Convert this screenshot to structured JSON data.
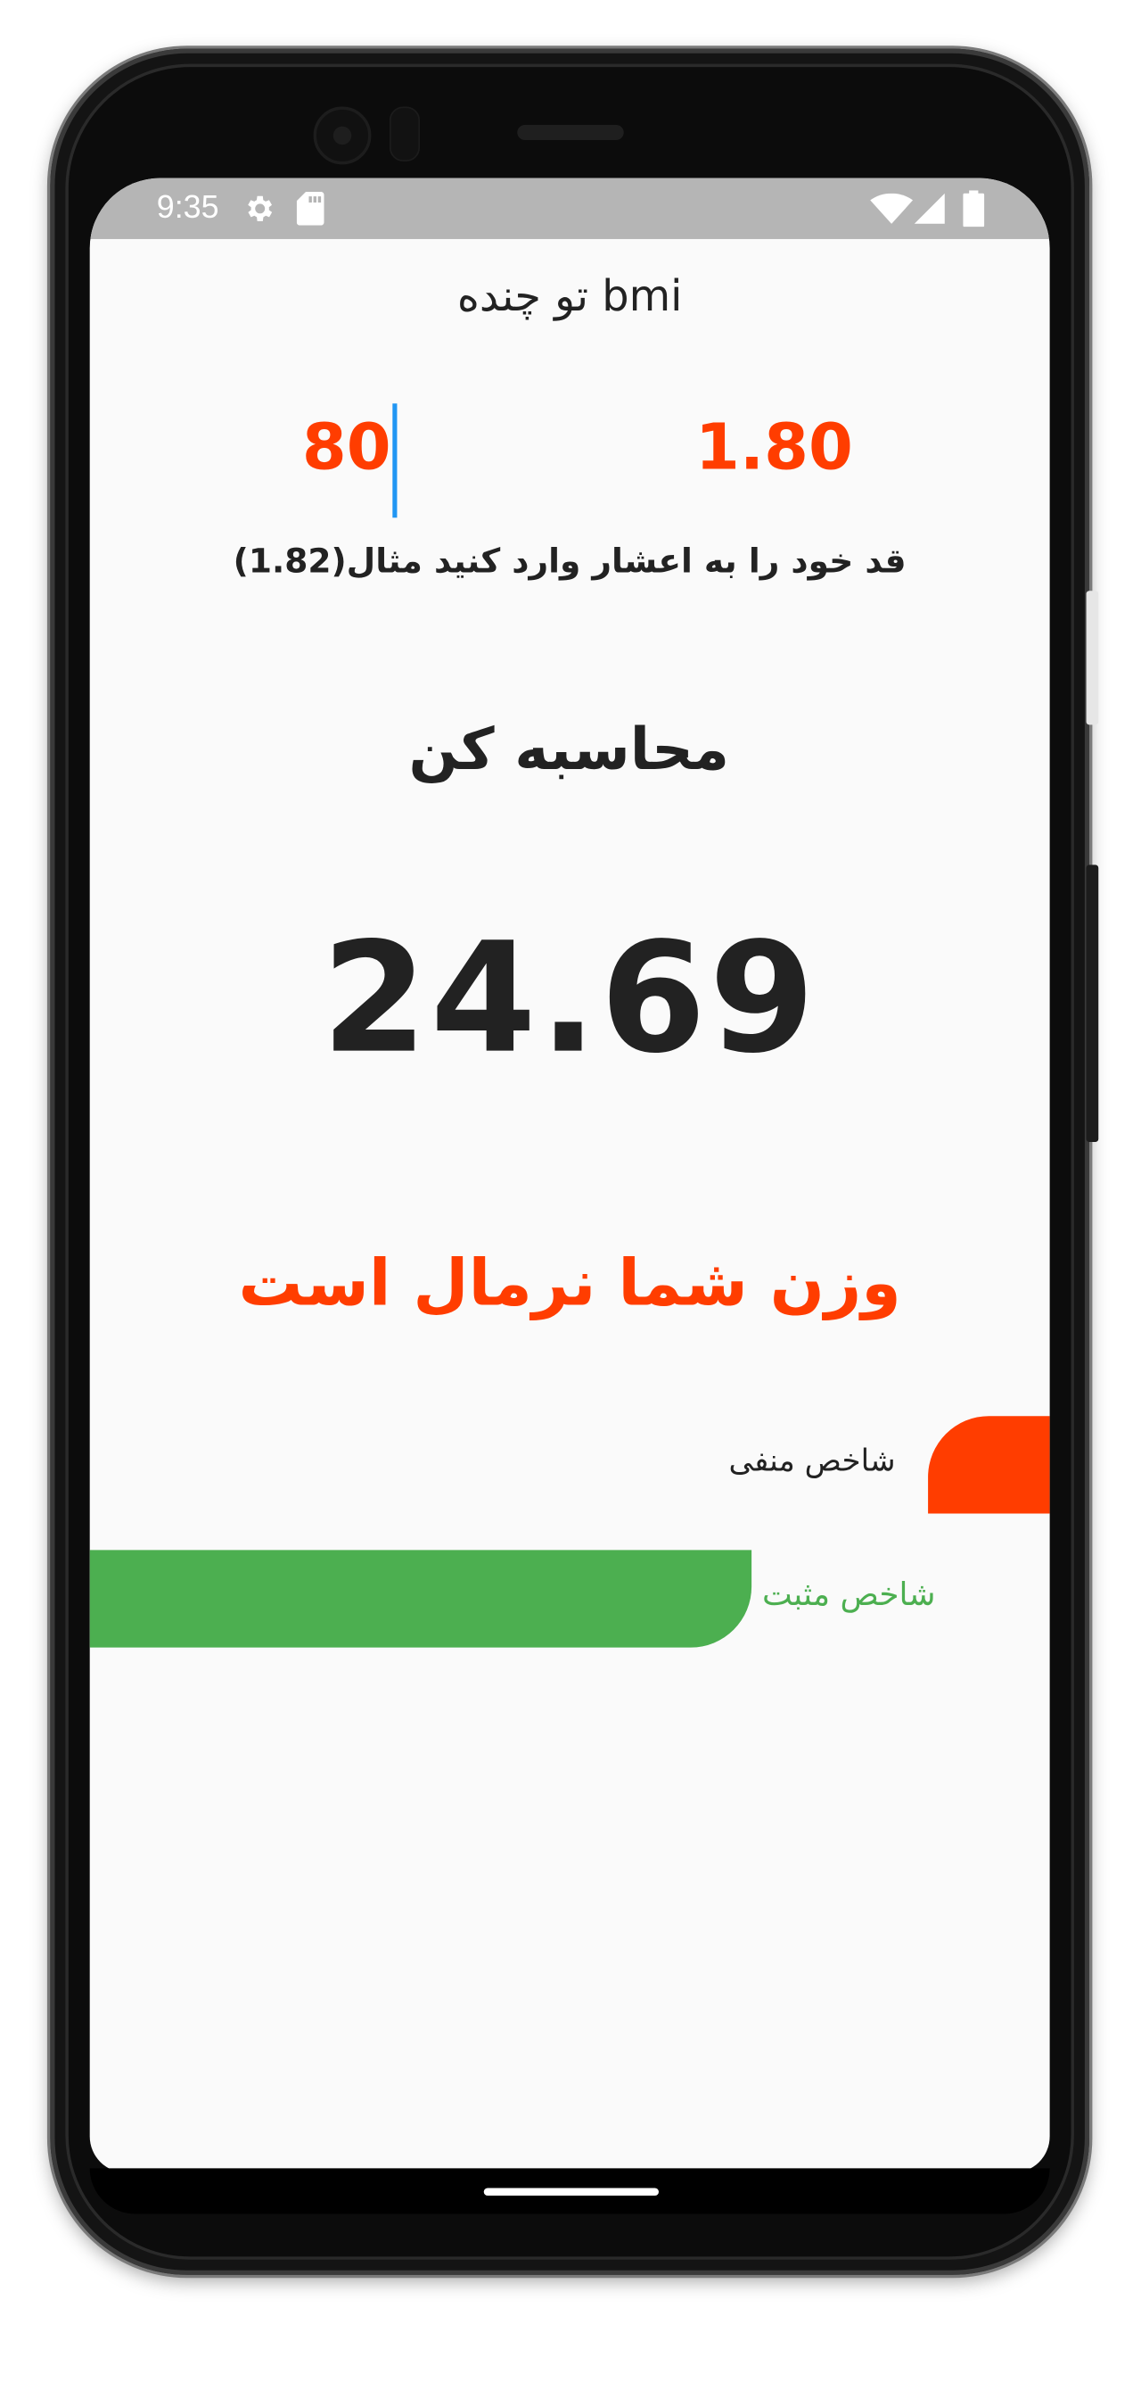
{
  "status_bar": {
    "time": "9:35",
    "left_icons": [
      "settings-icon",
      "sd-card-icon"
    ],
    "right_icons": [
      "wifi-icon",
      "signal-icon",
      "battery-icon"
    ]
  },
  "app": {
    "title": "bmi تو چنده",
    "weight_value": "80",
    "height_value": "1.80",
    "hint": "قد خود را به اعشار وارد کنید مثال(1.82)",
    "calculate_label": "محاسبه کن",
    "bmi_result": "24.69",
    "status_message": "وزن شما نرمال است",
    "negative_label": "شاخص منفی",
    "positive_label": "شاخص مثبت"
  },
  "colors": {
    "accent_orange": "#ff3d00",
    "positive_green": "#4caf50",
    "cursor_blue": "#2196f3",
    "status_bar_gray": "#b5b5b5",
    "screen_bg": "#fafafa"
  }
}
